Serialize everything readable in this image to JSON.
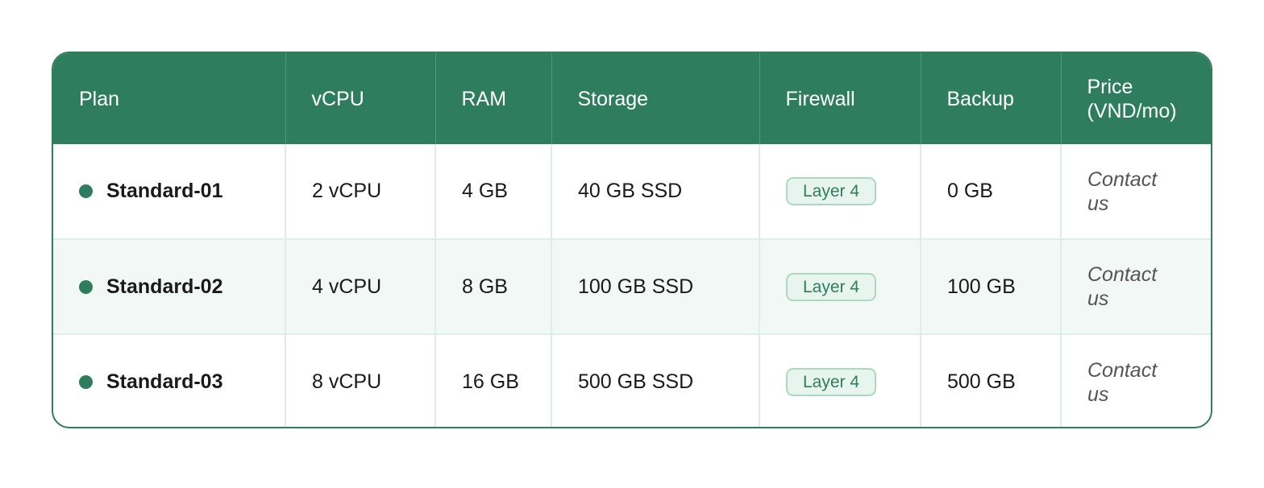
{
  "table": {
    "headers": {
      "plan": "Plan",
      "vcpu": "vCPU",
      "ram": "RAM",
      "storage": "Storage",
      "firewall": "Firewall",
      "backup": "Backup",
      "price": "Price (VND/mo)"
    },
    "rows": [
      {
        "plan": "Standard-01",
        "vcpu": "2 vCPU",
        "ram": "4 GB",
        "storage": "40 GB SSD",
        "firewall": "Layer 4",
        "backup": "0 GB",
        "price": "Contact us"
      },
      {
        "plan": "Standard-02",
        "vcpu": "4 vCPU",
        "ram": "8 GB",
        "storage": "100 GB SSD",
        "firewall": "Layer 4",
        "backup": "100 GB",
        "price": "Contact us"
      },
      {
        "plan": "Standard-03",
        "vcpu": "8 vCPU",
        "ram": "16 GB",
        "storage": "500 GB SSD",
        "firewall": "Layer 4",
        "backup": "500 GB",
        "price": "Contact us"
      }
    ]
  },
  "colors": {
    "header_background": "#2e7d5e",
    "accent": "#2e7d5e",
    "alt_row_background": "#f2f8f5",
    "badge_background": "#e8f5ee",
    "badge_border": "#a9d9c2"
  },
  "icons": {
    "plan_status": "status-dot-icon"
  }
}
